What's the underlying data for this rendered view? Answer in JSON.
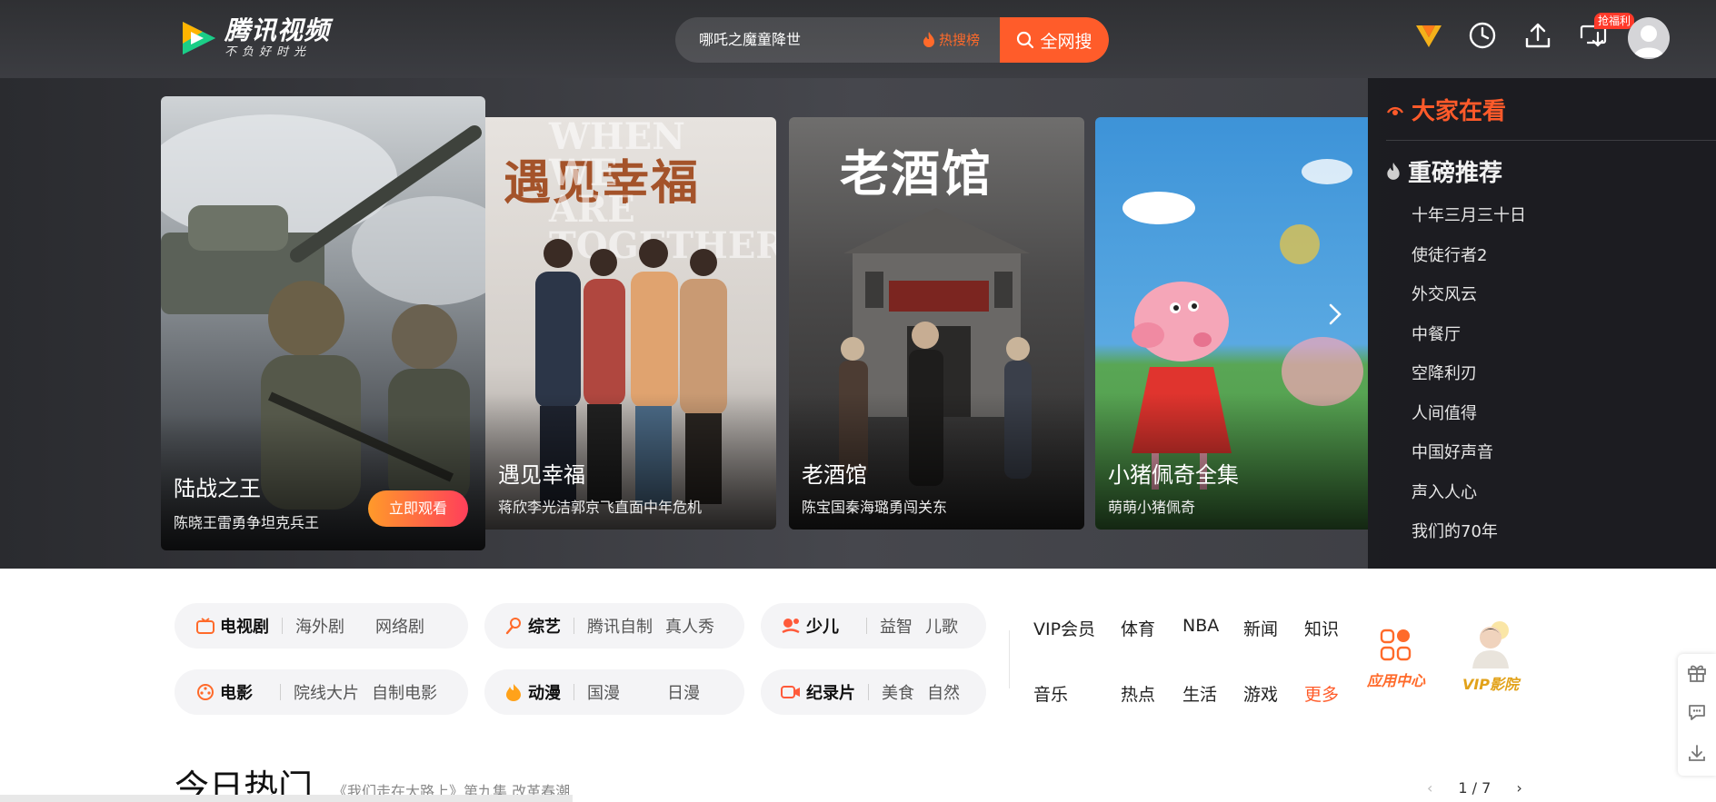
{
  "header": {
    "logo_title": "腾讯视频",
    "logo_slogan": "不负好时光",
    "search_value": "哪吒之魔童降世",
    "hot_list_label": "热搜榜",
    "search_button_label": "全网搜",
    "welfare_badge": "抢福利",
    "accent_color": "#ff5c2a"
  },
  "banner": {
    "cards": [
      {
        "title": "陆战之王",
        "subtitle": "陈晓王雷勇争坦克兵王",
        "button": "立即观看"
      },
      {
        "title": "遇见幸福",
        "subtitle": "蒋欣李光洁郭京飞直面中年危机",
        "poster_title": "遇见幸福",
        "poster_en": "WHEN WE ARE TOGETHER"
      },
      {
        "title": "老酒馆",
        "subtitle": "陈宝国秦海璐勇闯关东",
        "poster_title": "老酒馆"
      },
      {
        "title": "小猪佩奇全集",
        "subtitle": "萌萌小猪佩奇"
      }
    ]
  },
  "side": {
    "watching_label": "大家在看",
    "recommend_label": "重磅推荐",
    "items": [
      "十年三月三十日",
      "使徒行者2",
      "外交风云",
      "中餐厅",
      "空降利刃",
      "人间值得",
      "中国好声音",
      "声入人心",
      "我们的70年"
    ]
  },
  "nav": {
    "pills": [
      {
        "main": "电视剧",
        "links": [
          "海外剧",
          "网络剧"
        ]
      },
      {
        "main": "综艺",
        "links": [
          "腾讯自制",
          "真人秀"
        ]
      },
      {
        "main": "少儿",
        "links": [
          "益智",
          "儿歌"
        ]
      },
      {
        "main": "电影",
        "links": [
          "院线大片",
          "自制电影"
        ]
      },
      {
        "main": "动漫",
        "links": [
          "国漫",
          "日漫"
        ]
      },
      {
        "main": "纪录片",
        "links": [
          "美食",
          "自然"
        ]
      }
    ],
    "links_row1": [
      "VIP会员",
      "体育",
      "NBA",
      "新闻",
      "知识"
    ],
    "links_row2": [
      "音乐",
      "热点",
      "生活",
      "游戏",
      "更多"
    ],
    "app_center": "应用中心",
    "vip_cinema": "VIP影院"
  },
  "today": {
    "title": "今日热门",
    "subtitle": "《我们走在大路上》第九集 改革春潮",
    "page": "1 / 7"
  }
}
